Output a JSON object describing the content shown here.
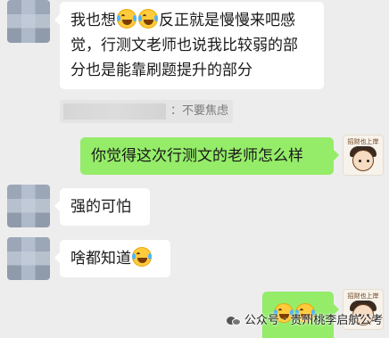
{
  "messages": [
    {
      "side": "left",
      "parts": [
        "我也想",
        "emoji:laugh-cry",
        "emoji:laugh-cry",
        "反正就是慢慢来吧感"
      ],
      "line2": "觉，行测文老师也说我比较弱的部",
      "line3": "分也是能靠刷题提升的部分"
    },
    {
      "side": "left",
      "quote_text": "：不要焦虑"
    },
    {
      "side": "right",
      "text": "你觉得这次行测文的老师怎么样"
    },
    {
      "side": "left",
      "text": "强的可怕"
    },
    {
      "side": "left",
      "text": "啥都知道"
    },
    {
      "side": "right",
      "text": ""
    }
  ],
  "sticker": {
    "banner": "招财也上岸"
  },
  "watermark": {
    "text": "公众号 · 贵州桃李启航公考"
  },
  "colors": {
    "background": "#ededed",
    "green_bubble": "#95ec69",
    "white_bubble": "#ffffff"
  }
}
